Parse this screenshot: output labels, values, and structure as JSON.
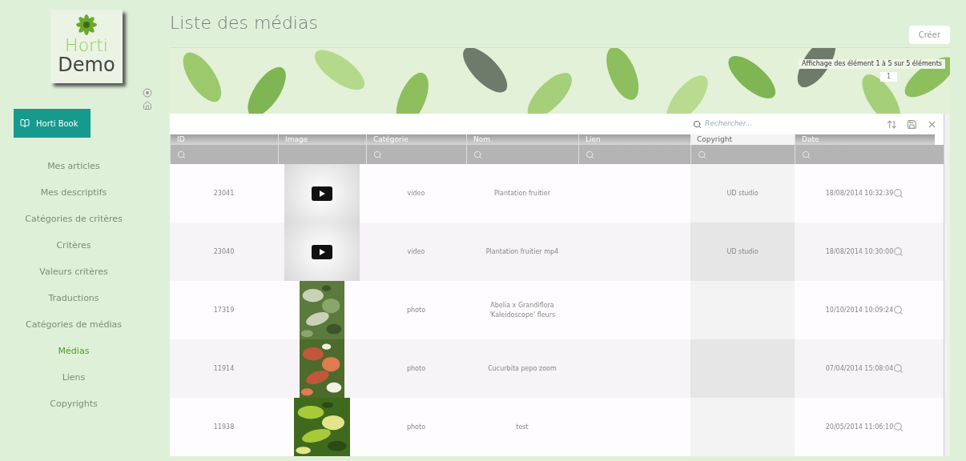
{
  "logo": {
    "line_1": "Horti",
    "line_2": "Demo"
  },
  "app_button": {
    "label": "Horti Book"
  },
  "sidebar": {
    "items": [
      {
        "label": "Mes articles",
        "selected": false
      },
      {
        "label": "Mes descriptifs",
        "selected": false
      },
      {
        "label": "Catégories de critères",
        "selected": false
      },
      {
        "label": "Critères",
        "selected": false
      },
      {
        "label": "Valeurs critères",
        "selected": false
      },
      {
        "label": "Traductions",
        "selected": false
      },
      {
        "label": "Catégories de médias",
        "selected": false
      },
      {
        "label": "Médias",
        "selected": true
      },
      {
        "label": "Liens",
        "selected": false
      },
      {
        "label": "Copyrights",
        "selected": false
      }
    ]
  },
  "page_title": "Liste des médias",
  "create_button": "Créer",
  "pagination": {
    "summary": "Affichage des élément 1 à 5 sur 5 éléments",
    "page": "1"
  },
  "search": {
    "placeholder": "Rechercher..."
  },
  "table": {
    "columns": [
      {
        "label": "ID",
        "sorted": false,
        "filter": true
      },
      {
        "label": "Image",
        "sorted": false,
        "filter": false
      },
      {
        "label": "Catégorie",
        "sorted": false,
        "filter": true
      },
      {
        "label": "Nom",
        "sorted": false,
        "filter": true
      },
      {
        "label": "Lien",
        "sorted": false,
        "filter": true
      },
      {
        "label": "Copyright",
        "sorted": true,
        "filter": true
      },
      {
        "label": "Date",
        "sorted": false,
        "filter": true
      }
    ],
    "rows": [
      {
        "id": "23041",
        "image": {
          "kind": "video"
        },
        "category": "video",
        "name": "Plantation fruitier",
        "link": "",
        "copyright": "UD studio",
        "date": "18/08/2014 10:32:39"
      },
      {
        "id": "23040",
        "image": {
          "kind": "video"
        },
        "category": "video",
        "name": "Plantation fruitier mp4",
        "link": "",
        "copyright": "UD studio",
        "date": "18/08/2014 10:30:00"
      },
      {
        "id": "17319",
        "category": "photo",
        "name": "Abelia x Grandiflora 'Kaleidoscope' fleurs",
        "link": "",
        "copyright": "",
        "date": "10/10/2014 10:09:24"
      },
      {
        "id": "11914",
        "category": "photo",
        "name": "Cucurbita pepo zoom",
        "link": "",
        "copyright": "",
        "date": "07/04/2014 15:08:04"
      },
      {
        "id": "11938",
        "category": "photo",
        "name": "test",
        "link": "",
        "copyright": "",
        "date": "20/05/2014 11:06:10"
      }
    ]
  }
}
